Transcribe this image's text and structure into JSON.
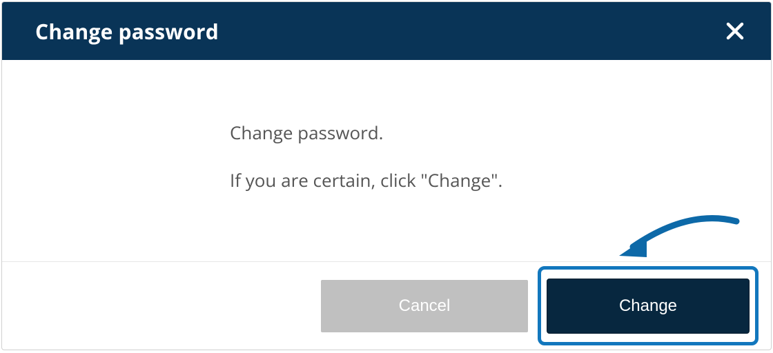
{
  "dialog": {
    "title": "Change password",
    "body_line1": "Change password.",
    "body_line2": "If you are certain, click \"Change\"."
  },
  "footer": {
    "cancel_label": "Cancel",
    "change_label": "Change"
  }
}
